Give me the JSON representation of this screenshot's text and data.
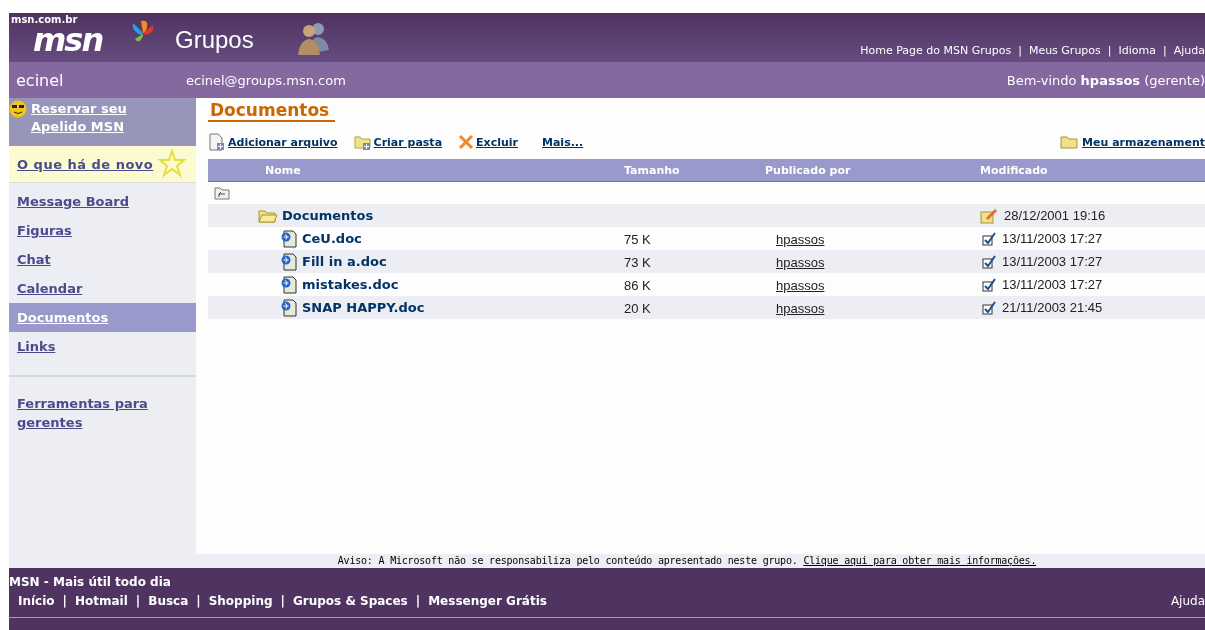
{
  "header": {
    "domain": "msn.com.br",
    "logo": "msn",
    "title": "Grupos",
    "separator": "|",
    "links": [
      "Home Page do MSN Grupos",
      "Meus Grupos",
      "Idioma",
      "Ajuda"
    ]
  },
  "subheader": {
    "group": "ecinel",
    "email": "ecinel@groups.msn.com",
    "welcome": "Bem-vindo",
    "user": "hpassos",
    "role": "(gerente)"
  },
  "sidebar": {
    "promo": "Reservar seu Apelido MSN",
    "news": "O que há de novo",
    "items": [
      {
        "label": "Message Board",
        "selected": false
      },
      {
        "label": "Figuras",
        "selected": false
      },
      {
        "label": "Chat",
        "selected": false
      },
      {
        "label": "Calendar",
        "selected": false
      },
      {
        "label": "Documentos",
        "selected": true
      },
      {
        "label": "Links",
        "selected": false
      }
    ],
    "tools": "Ferramentas para gerentes"
  },
  "page_title": "Documentos",
  "toolbar": {
    "actions": [
      {
        "kind": "add",
        "label": "Adicionar arquivo"
      },
      {
        "kind": "folder",
        "label": "Criar pasta"
      },
      {
        "kind": "delete",
        "label": "Excluir"
      },
      {
        "kind": "more",
        "label": "Mais..."
      }
    ],
    "storage": "Meu armazenament"
  },
  "table": {
    "columns": [
      "Nome",
      "Tamanho",
      "Publicado por",
      "Modificado"
    ],
    "rows": [
      {
        "kind": "folder",
        "name": "Documentos",
        "modified": "28/12/2001 19:16"
      },
      {
        "kind": "file",
        "name": "CeU.doc",
        "size": "75 K",
        "author": "hpassos",
        "modified": "13/11/2003 17:27"
      },
      {
        "kind": "file",
        "name": "Fill in a.doc",
        "size": "73 K",
        "author": "hpassos",
        "modified": "13/11/2003 17:27"
      },
      {
        "kind": "file",
        "name": "mistakes.doc",
        "size": "86 K",
        "author": "hpassos",
        "modified": "13/11/2003 17:27"
      },
      {
        "kind": "file",
        "name": "SNAP HAPPY.doc",
        "size": "20 K",
        "author": "hpassos",
        "modified": "21/11/2003 21:45"
      }
    ]
  },
  "notice": {
    "text": "Aviso: A Microsoft não se responsabiliza pelo conteúdo apresentado neste grupo.",
    "link": "Clique aqui para obter mais informações."
  },
  "footer": {
    "tagline": "MSN - Mais útil todo dia",
    "separator": "|",
    "links": [
      "Início",
      "Hotmail",
      "Busca",
      "Shopping",
      "Grupos & Spaces",
      "Messenger Grátis"
    ],
    "help": "Ajuda"
  }
}
